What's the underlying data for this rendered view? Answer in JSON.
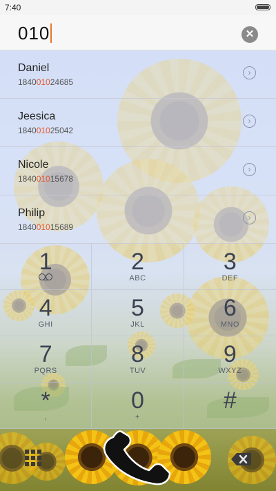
{
  "status_bar": {
    "time": "7:40"
  },
  "dialer": {
    "dialed_number": "010"
  },
  "contacts": [
    {
      "name": "Daniel",
      "number_prefix": "1840",
      "number_match": "010",
      "number_suffix": "24685"
    },
    {
      "name": "Jeesica",
      "number_prefix": "1840",
      "number_match": "010",
      "number_suffix": "25042"
    },
    {
      "name": "Nicole",
      "number_prefix": "1840",
      "number_match": "010",
      "number_suffix": "15678"
    },
    {
      "name": "Philip",
      "number_prefix": "1840",
      "number_match": "010",
      "number_suffix": "15689"
    }
  ],
  "keypad": [
    {
      "digit": "1",
      "letters": ""
    },
    {
      "digit": "2",
      "letters": "ABC"
    },
    {
      "digit": "3",
      "letters": "DEF"
    },
    {
      "digit": "4",
      "letters": "GHI"
    },
    {
      "digit": "5",
      "letters": "JKL"
    },
    {
      "digit": "6",
      "letters": "MNO"
    },
    {
      "digit": "7",
      "letters": "PQRS"
    },
    {
      "digit": "8",
      "letters": "TUV"
    },
    {
      "digit": "9",
      "letters": "WXYZ"
    },
    {
      "digit": "*",
      "letters": ","
    },
    {
      "digit": "0",
      "letters": "+"
    },
    {
      "digit": "#",
      "letters": ""
    }
  ],
  "colors": {
    "accent": "#e8572c",
    "caret": "#e8762c",
    "digit": "#3c4252"
  },
  "icons": {
    "clear": "clear-circle-x-icon",
    "contact_detail": "chevron-right-circle-icon",
    "voicemail": "voicemail-icon",
    "keypad_toggle": "dialpad-grid-icon",
    "call": "phone-handset-icon",
    "backspace": "backspace-icon"
  }
}
